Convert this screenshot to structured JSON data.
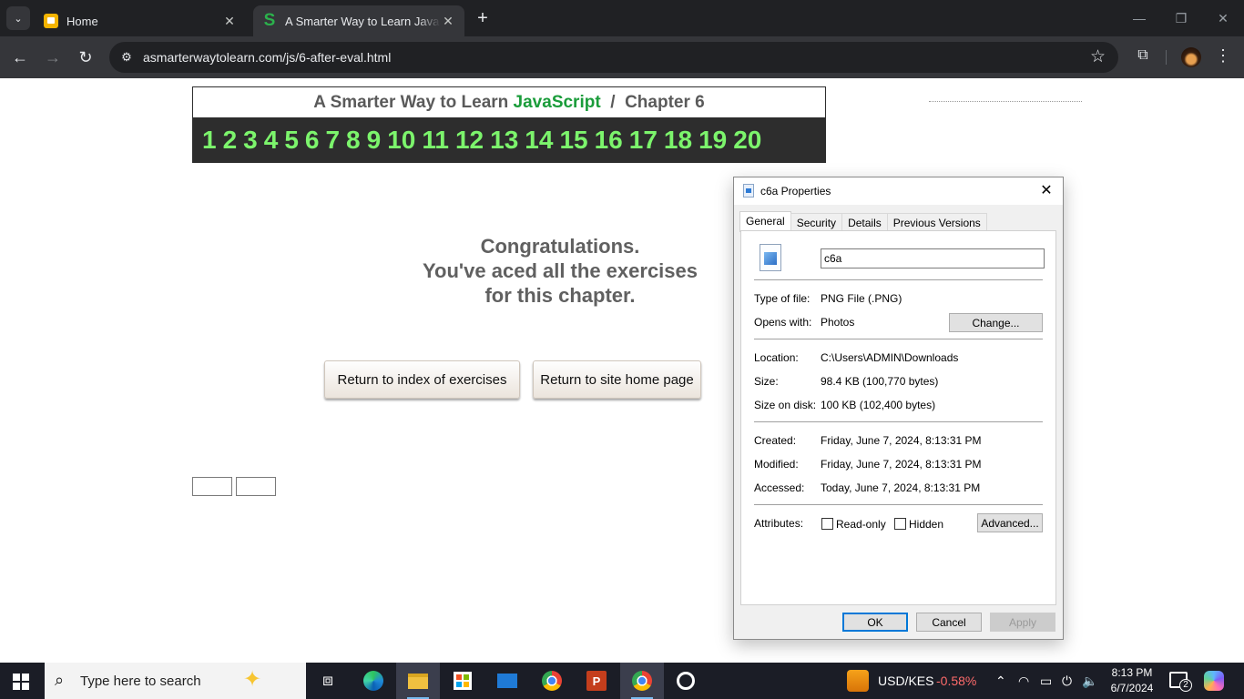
{
  "browser": {
    "tabs": [
      {
        "title": "Home",
        "active": false
      },
      {
        "title": "A Smarter Way to Learn JavaScript",
        "active": true
      }
    ],
    "url": "asmarterwaytolearn.com/js/6-after-eval.html"
  },
  "page": {
    "header": {
      "prefix": "A Smarter Way to Learn",
      "brand": "JavaScript",
      "separator": "/",
      "chapter": "Chapter 6"
    },
    "chapters": [
      "1",
      "2",
      "3",
      "4",
      "5",
      "6",
      "7",
      "8",
      "9",
      "10",
      "11",
      "12",
      "13",
      "14",
      "15",
      "16",
      "17",
      "18",
      "19",
      "20"
    ],
    "congrats": [
      "Congratulations.",
      "You've aced all the exercises",
      "for this chapter."
    ],
    "buttons": {
      "index": "Return to index of exercises",
      "home": "Return to site home page"
    }
  },
  "dialog": {
    "title": "c6a Properties",
    "tabs": [
      "General",
      "Security",
      "Details",
      "Previous Versions"
    ],
    "file_name": "c6a",
    "type_label": "Type of file:",
    "type_value": "PNG File (.PNG)",
    "opens_label": "Opens with:",
    "opens_value": "Photos",
    "change_btn": "Change...",
    "location_label": "Location:",
    "location_value": "C:\\Users\\ADMIN\\Downloads",
    "size_label": "Size:",
    "size_value": "98.4 KB (100,770 bytes)",
    "disk_label": "Size on disk:",
    "disk_value": "100 KB (102,400 bytes)",
    "created_label": "Created:",
    "created_value": "Friday, June 7, 2024, 8:13:31 PM",
    "modified_label": "Modified:",
    "modified_value": "Friday, June 7, 2024, 8:13:31 PM",
    "accessed_label": "Accessed:",
    "accessed_value": "Today, June 7, 2024, 8:13:31 PM",
    "attributes_label": "Attributes:",
    "readonly_label": "Read-only",
    "hidden_label": "Hidden",
    "advanced_btn": "Advanced...",
    "ok_btn": "OK",
    "cancel_btn": "Cancel",
    "apply_btn": "Apply"
  },
  "taskbar": {
    "search_placeholder": "Type here to search",
    "ticker_name": "USD/KES",
    "ticker_change": "-0.58%",
    "time": "8:13 PM",
    "date": "6/7/2024",
    "notification_count": "2"
  }
}
